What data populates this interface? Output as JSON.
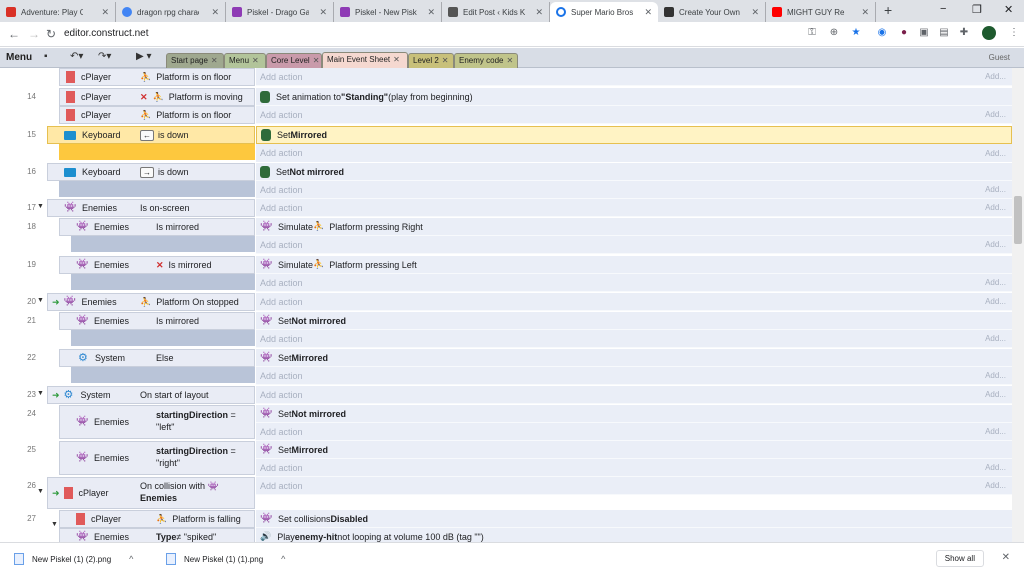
{
  "browser": {
    "tabs": [
      {
        "label": "Adventure: Play Ga",
        "color": "#d93025"
      },
      {
        "label": "dragon rpg charac",
        "color": "#4285f4"
      },
      {
        "label": "Piskel - Drago Gam",
        "color": "#8e3bb5"
      },
      {
        "label": "Piskel - New Piskel",
        "color": "#8e3bb5"
      },
      {
        "label": "Edit Post ‹ Kids Ko",
        "color": "#555555"
      },
      {
        "label": "Super Mario Bros",
        "color": "#1a73e8"
      },
      {
        "label": "Create Your Own G",
        "color": "#333333"
      },
      {
        "label": "MIGHT GUY Re",
        "color": "#ff0000"
      }
    ],
    "url": "editor.construct.net",
    "new_tab": "+",
    "minimize": "−",
    "maximize": "❐",
    "close": "✕"
  },
  "editor": {
    "menu_label": "Menu",
    "tabs": [
      {
        "label": "Start page",
        "color": "#9fa88f"
      },
      {
        "label": "Menu",
        "color": "#b2c49a"
      },
      {
        "label": "Core Level",
        "color": "#c99aaa"
      },
      {
        "label": "Main Event Sheet",
        "color": "#f5d8d0"
      },
      {
        "label": "Level 2",
        "color": "#c8c07a"
      },
      {
        "label": "Enemy code",
        "color": "#c0c48a"
      }
    ],
    "guest": "Guest"
  },
  "sheet": {
    "add_action": "Add action",
    "add_short": "Add...",
    "rows": {
      "r13": {
        "obj": "cPlayer",
        "cond": "Platform is on floor"
      },
      "r14": {
        "num": "14",
        "obj1": "cPlayer",
        "cond1": "Platform is moving",
        "obj2": "cPlayer",
        "cond2": "Platform is on floor",
        "act_pre": "Set animation to ",
        "act_bold": "\"Standing\"",
        "act_post": " (play from beginning)"
      },
      "r15": {
        "num": "15",
        "obj": "Keyboard",
        "key": "←",
        "cond": "is down",
        "act_pre": "Set ",
        "act_bold": "Mirrored"
      },
      "r16": {
        "num": "16",
        "obj": "Keyboard",
        "key": "→",
        "cond": "is down",
        "act_pre": "Set ",
        "act_bold": "Not mirrored"
      },
      "r17": {
        "num": "17",
        "obj": "Enemies",
        "cond": "Is on-screen"
      },
      "r18": {
        "num": "18",
        "obj": "Enemies",
        "cond": "Is mirrored",
        "act_pre": "Simulate ",
        "act_mid": "Platform pressing Right"
      },
      "r19": {
        "num": "19",
        "obj": "Enemies",
        "cond": "Is mirrored",
        "act_pre": "Simulate ",
        "act_mid": "Platform pressing Left"
      },
      "r20": {
        "num": "20",
        "obj": "Enemies",
        "cond": "Platform On stopped"
      },
      "r21": {
        "num": "21",
        "obj": "Enemies",
        "cond": "Is mirrored",
        "act_pre": "Set ",
        "act_bold": "Not mirrored"
      },
      "r22": {
        "num": "22",
        "obj": "System",
        "cond": "Else",
        "act_pre": "Set ",
        "act_bold": "Mirrored"
      },
      "r23": {
        "num": "23",
        "obj": "System",
        "cond": "On start of layout"
      },
      "r24": {
        "num": "24",
        "obj": "Enemies",
        "cond_bold": "startingDirection",
        "cond_eq": " =",
        "cond_val": "\"left\"",
        "act_pre": "Set ",
        "act_bold": "Not mirrored"
      },
      "r25": {
        "num": "25",
        "obj": "Enemies",
        "cond_bold": "startingDirection",
        "cond_eq": " =",
        "cond_val": "\"right\"",
        "act_pre": "Set ",
        "act_bold": "Mirrored"
      },
      "r26": {
        "num": "26",
        "obj": "cPlayer",
        "cond_pre": "On collision with",
        "cond_bold": "Enemies"
      },
      "r27": {
        "num": "27",
        "obj1": "cPlayer",
        "cond1": "Platform is falling",
        "obj2": "Enemies",
        "cond2_bold": "Type",
        "cond2_post": " ≠ \"spiked\"",
        "act1_pre": "Set collisions ",
        "act1_bold": "Disabled",
        "act2_pre": "Play ",
        "act2_bold": "enemy-hit",
        "act2_post": " not looping at volume 100 dB (tag \"\")"
      }
    }
  },
  "downloads": {
    "items": [
      {
        "label": "New Piskel (1) (2).png"
      },
      {
        "label": "New Piskel (1) (1).png"
      }
    ],
    "show_all": "Show all",
    "close": "✕"
  }
}
